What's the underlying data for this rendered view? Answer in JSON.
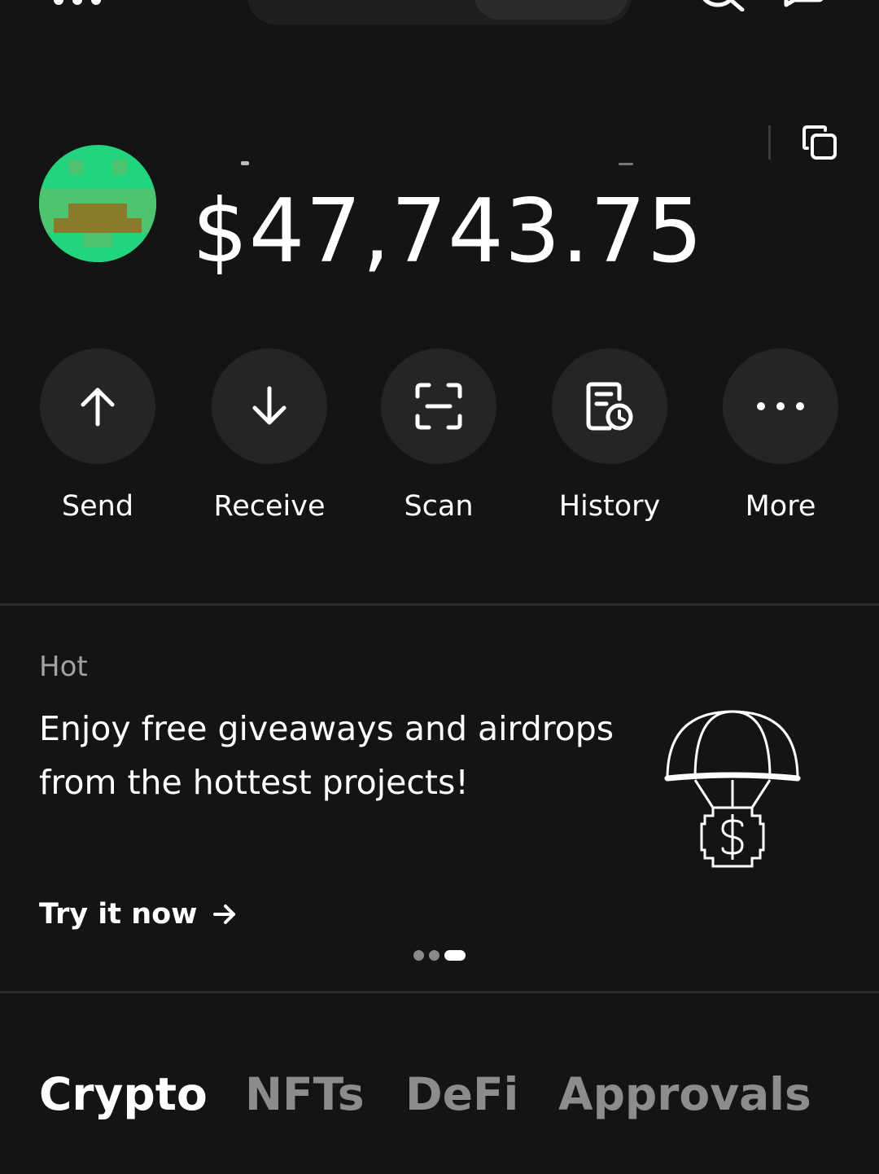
{
  "header": {
    "balance": "$47,743.75"
  },
  "actions": [
    {
      "label": "Send",
      "icon": "arrow-up-icon"
    },
    {
      "label": "Receive",
      "icon": "arrow-down-icon"
    },
    {
      "label": "Scan",
      "icon": "scan-icon"
    },
    {
      "label": "History",
      "icon": "history-icon"
    },
    {
      "label": "More",
      "icon": "more-dots-icon"
    }
  ],
  "promo": {
    "tag": "Hot",
    "text": "Enjoy free giveaways and airdrops from the hottest projects!",
    "cta": "Try it now",
    "illustration": "parachute-airdrop-icon",
    "carousel": {
      "total": 3,
      "active": 3
    }
  },
  "tabs": [
    {
      "label": "Crypto",
      "active": true
    },
    {
      "label": "NFTs",
      "active": false
    },
    {
      "label": "DeFi",
      "active": false
    },
    {
      "label": "Approvals",
      "active": false
    }
  ],
  "colors": {
    "background": "#141414",
    "surface": "#252525",
    "text_primary": "#ffffff",
    "text_secondary": "#a3a3a3",
    "tab_inactive": "#8c8c8c",
    "avatar_green": "#22d47e",
    "avatar_brown": "#8a7a2c"
  }
}
